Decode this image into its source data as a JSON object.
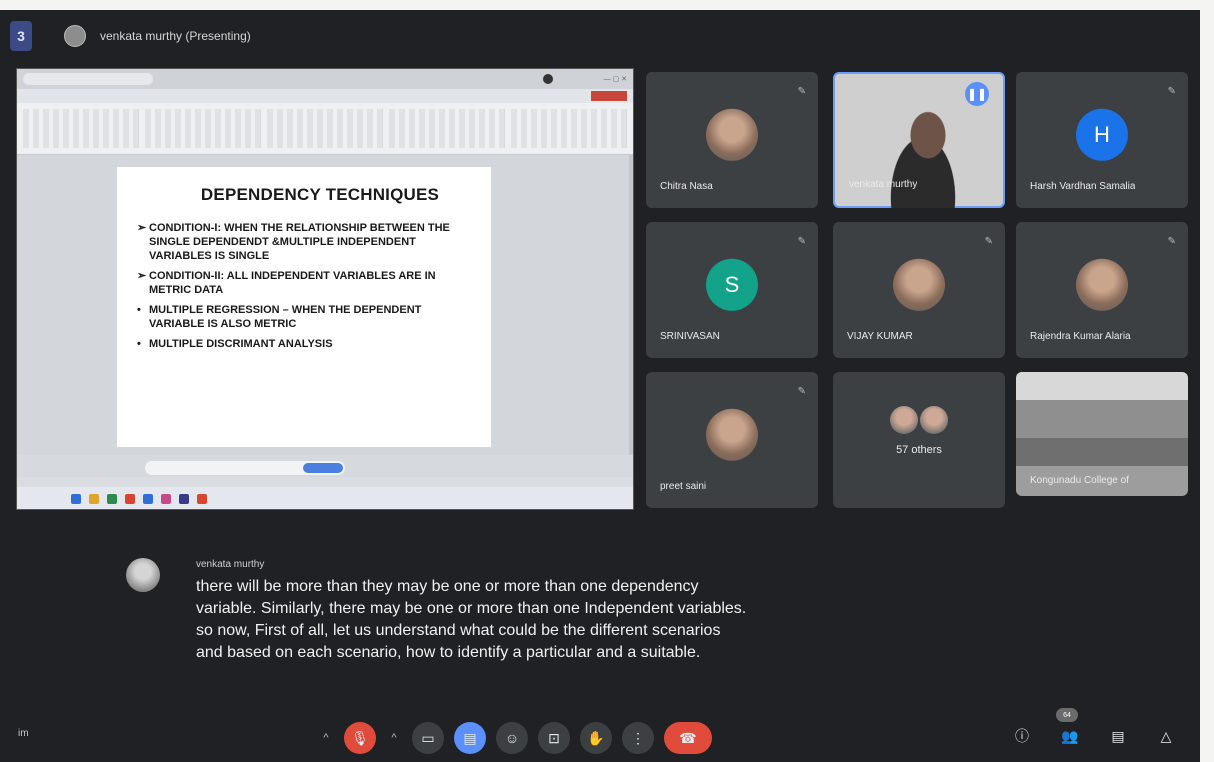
{
  "presenter": {
    "label": "venkata murthy (Presenting)"
  },
  "menu_icon": "3",
  "slide": {
    "title": "DEPENDENCY TECHNIQUES",
    "bullets": [
      {
        "mark": "➢",
        "text": "CONDITION-I: WHEN THE RELATIONSHIP BETWEEN THE SINGLE DEPENDENDT &MULTIPLE INDEPENDENT VARIABLES IS SINGLE"
      },
      {
        "mark": "➢",
        "text": "CONDITION-II: ALL INDEPENDENT VARIABLES ARE IN METRIC DATA"
      },
      {
        "mark": "•",
        "text": "MULTIPLE REGRESSION – WHEN THE DEPENDENT VARIABLE IS ALSO METRIC"
      },
      {
        "mark": "•",
        "text": "MULTIPLE DISCRIMANT ANALYSIS"
      }
    ]
  },
  "participants": [
    {
      "name": "Chitra Nasa",
      "type": "photo"
    },
    {
      "name": "venkata murthy",
      "type": "video"
    },
    {
      "name": "Harsh Vardhan Samalia",
      "type": "initial",
      "initial": "H",
      "color": "#1a73e8"
    },
    {
      "name": "SRINIVASAN",
      "type": "initial",
      "initial": "S",
      "color": "#12a38a"
    },
    {
      "name": "VIJAY KUMAR",
      "type": "photo"
    },
    {
      "name": "Rajendra Kumar Alaria",
      "type": "photo"
    },
    {
      "name": "preet saini",
      "type": "photo"
    },
    {
      "name": "57 others",
      "type": "others"
    },
    {
      "name": "Kongunadu College of",
      "type": "room"
    }
  ],
  "others_count": "57 others",
  "caption": {
    "speaker": "venkata murthy",
    "lines": [
      "there will be more than they may be one or more than one dependency",
      "variable. Similarly, there may be one or more than one Independent variables.",
      "so now, First of all, let us understand what could be the different scenarios",
      "and based on each scenario, how to identify a particular and a suitable."
    ]
  },
  "meeting_code": "im",
  "people_count": "64",
  "icons": {
    "mic": "mic-off-icon",
    "camera": "camera-icon",
    "captions": "captions-icon",
    "emoji": "emoji-icon",
    "present": "present-screen-icon",
    "hand": "raise-hand-icon",
    "more": "more-options-icon",
    "end": "end-call-icon",
    "info": "info-icon",
    "people": "people-icon",
    "chat": "chat-icon",
    "activities": "activities-icon"
  }
}
